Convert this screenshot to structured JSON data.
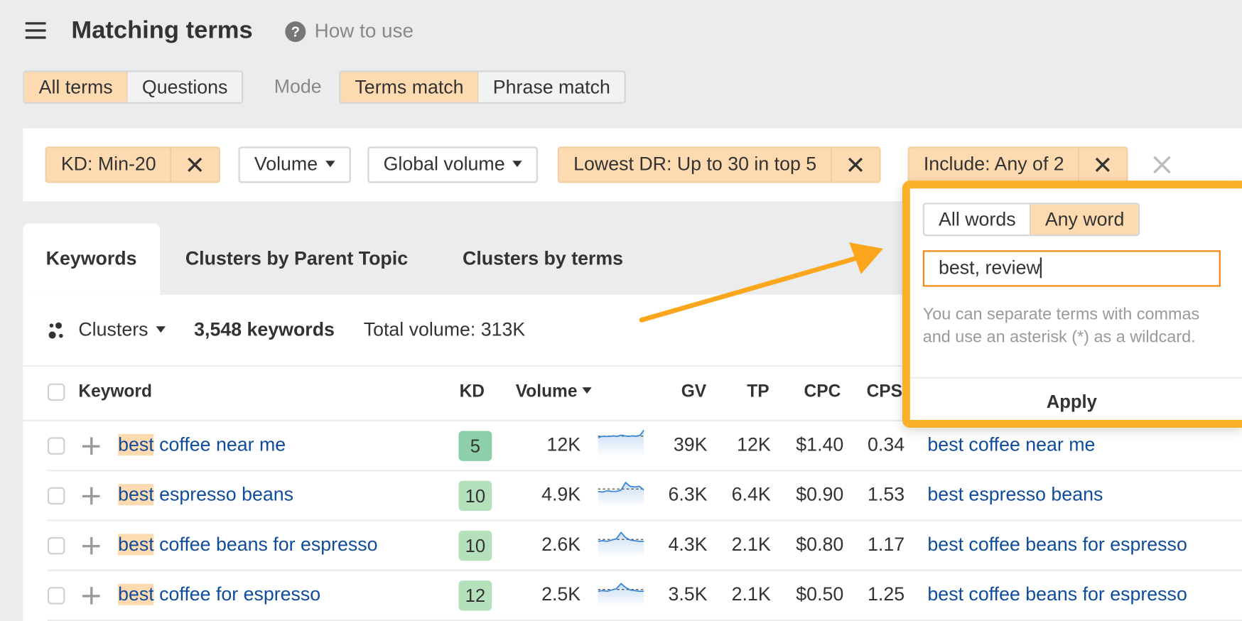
{
  "header": {
    "menu_icon": "hamburger-icon",
    "title": "Matching terms",
    "help_icon": "question-circle-icon",
    "help_glyph": "?",
    "how_to_use": "How to use"
  },
  "terms_toggle": {
    "options": [
      "All terms",
      "Questions"
    ],
    "selected": "All terms"
  },
  "mode": {
    "label": "Mode",
    "options": [
      "Terms match",
      "Phrase match"
    ],
    "selected": "Terms match"
  },
  "filters": [
    {
      "label": "KD: Min-20",
      "active": true,
      "removable": true
    },
    {
      "label": "Volume",
      "active": false,
      "dropdown": true
    },
    {
      "label": "Global volume",
      "active": false,
      "dropdown": true
    },
    {
      "label": "Lowest DR: Up to 30 in top 5",
      "active": true,
      "removable": true
    },
    {
      "label": "Include: Any of 2",
      "active": true,
      "removable": true
    }
  ],
  "clear_filters_icon": "close-icon",
  "tabs": [
    {
      "label": "Keywords",
      "active": true
    },
    {
      "label": "Clusters by Parent Topic",
      "active": false
    },
    {
      "label": "Clusters by terms",
      "active": false
    }
  ],
  "summary": {
    "clusters_label": "Clusters",
    "keywords_count": "3,548 keywords",
    "total_volume": "Total volume: 313K"
  },
  "table": {
    "columns": [
      "Keyword",
      "KD",
      "Volume",
      "GV",
      "TP",
      "CPC",
      "CPS"
    ],
    "sort_column": "Volume",
    "highlight_term": "best",
    "rows": [
      {
        "keyword_hl": "best",
        "keyword_rest": " coffee near me",
        "kd": "5",
        "kd_color": "#8dcfa8",
        "volume": "12K",
        "gv": "39K",
        "tp": "12K",
        "cpc": "$1.40",
        "cps": "0.34",
        "parent_topic": "best coffee near me",
        "trend": [
          6,
          5,
          5,
          5,
          4.5,
          5,
          4,
          4.5,
          5,
          4.5,
          4.8,
          4,
          0
        ]
      },
      {
        "keyword_hl": "best",
        "keyword_rest": " espresso beans",
        "kd": "10",
        "kd_color": "#b5e0bc",
        "volume": "4.9K",
        "gv": "6.3K",
        "tp": "6.4K",
        "cpc": "$0.90",
        "cps": "1.53",
        "parent_topic": "best espresso beans",
        "trend": [
          9,
          9.5,
          8.5,
          9,
          9,
          8,
          2,
          5,
          5.5,
          5,
          8
        ]
      },
      {
        "keyword_hl": "best",
        "keyword_rest": " coffee beans for espresso",
        "kd": "10",
        "kd_color": "#b5e0bc",
        "volume": "2.6K",
        "gv": "4.3K",
        "tp": "2.1K",
        "cpc": "$0.80",
        "cps": "1.17",
        "parent_topic": "best coffee beans for espresso",
        "trend": [
          9,
          8.5,
          9,
          8,
          7,
          2,
          6,
          8,
          8.5,
          9,
          9
        ]
      },
      {
        "keyword_hl": "best",
        "keyword_rest": " coffee for espresso",
        "kd": "12",
        "kd_color": "#b5e0bc",
        "volume": "2.5K",
        "gv": "3.5K",
        "tp": "2.1K",
        "cpc": "$0.50",
        "cps": "1.25",
        "parent_topic": "best coffee beans for espresso",
        "trend": [
          9,
          8.5,
          9,
          8,
          7,
          3,
          6,
          8,
          8.5,
          9,
          9
        ]
      }
    ]
  },
  "include_popup": {
    "match_options": [
      "All words",
      "Any word"
    ],
    "selected": "Any word",
    "input_value": "best, review",
    "hint": "You can separate terms with commas and use an asterisk (*) as a wildcard.",
    "apply_label": "Apply"
  },
  "colors": {
    "accent_orange": "#fbb02a",
    "chip_active": "#fedab0",
    "link_blue": "#0f4c9c",
    "sparkline": "#3a87d6"
  }
}
